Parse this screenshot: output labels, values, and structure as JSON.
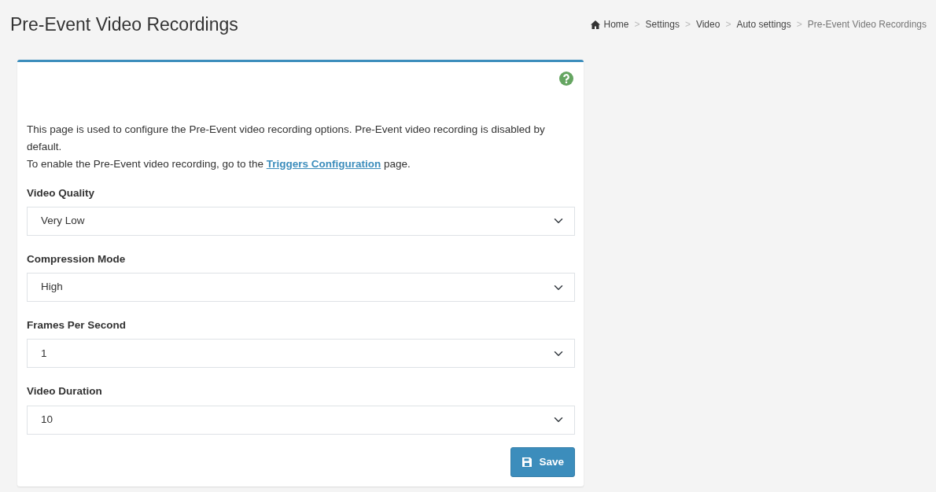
{
  "page_title": "Pre-Event Video Recordings",
  "breadcrumb": {
    "separator": ">",
    "items": [
      {
        "label": "Home",
        "kind": "home"
      },
      {
        "label": "Settings",
        "kind": "link"
      },
      {
        "label": "Video",
        "kind": "link"
      },
      {
        "label": "Auto settings",
        "kind": "link"
      },
      {
        "label": "Pre-Event Video Recordings",
        "kind": "current"
      }
    ]
  },
  "description": {
    "line_1": "This page is used to configure the Pre-Event video recording options. Pre-Event video recording is disabled by default.",
    "line_2_before": "To enable the Pre-Event video recording, go to the",
    "line_2_link": "Triggers Configuration",
    "line_2_after": "page."
  },
  "fields": [
    {
      "label": "Video Quality",
      "value": "Very Low"
    },
    {
      "label": "Compression Mode",
      "value": "High"
    },
    {
      "label": "Frames Per Second",
      "value": "1"
    },
    {
      "label": "Video Duration",
      "value": "10"
    }
  ],
  "save_button": "Save"
}
